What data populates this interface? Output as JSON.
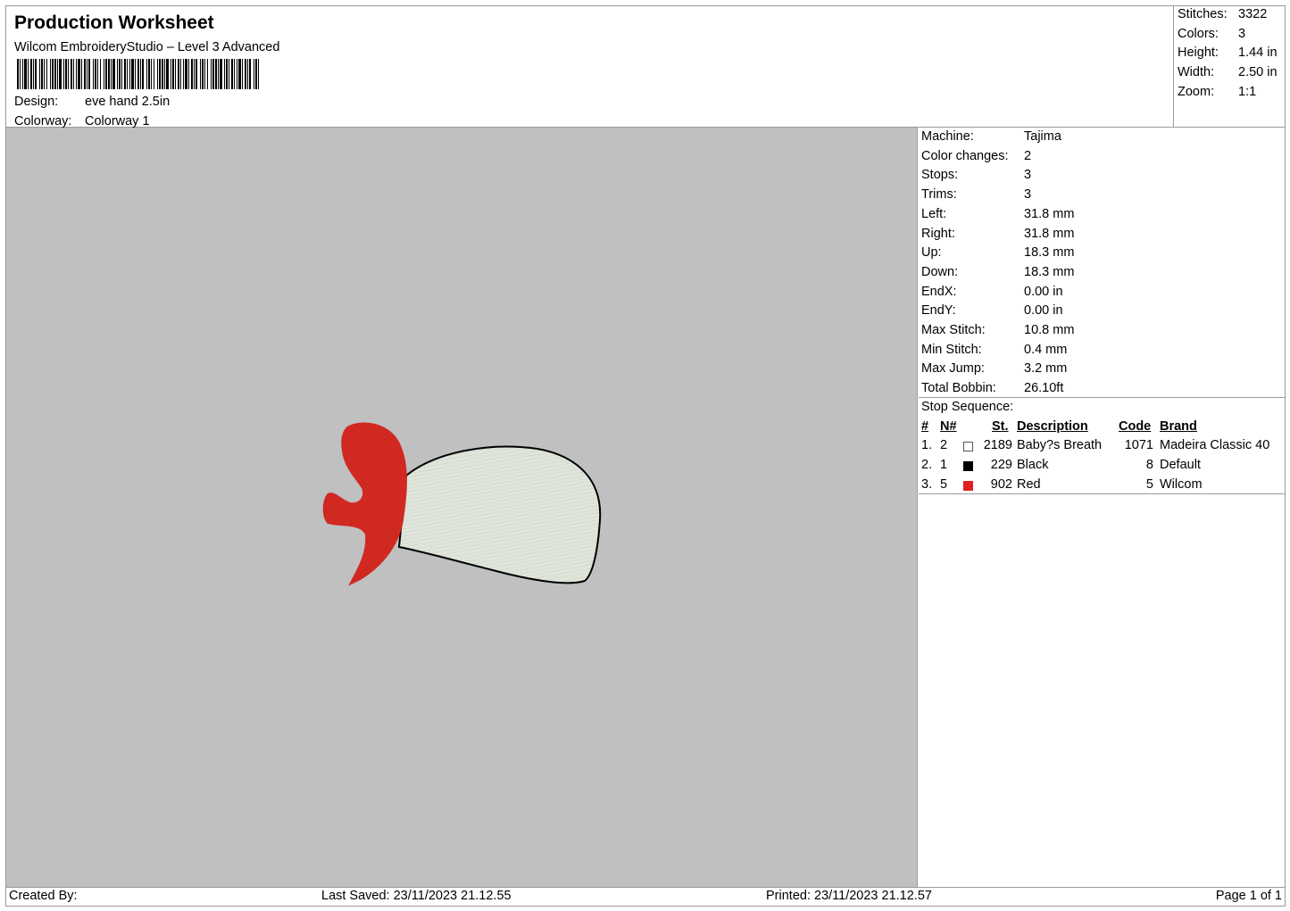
{
  "header": {
    "title": "Production Worksheet",
    "software": "Wilcom EmbroideryStudio – Level 3 Advanced",
    "design_label": "Design:",
    "design_value": "eve hand 2.5in",
    "colorway_label": "Colorway:",
    "colorway_value": "Colorway 1"
  },
  "summary": {
    "stitches_label": "Stitches:",
    "stitches": "3322",
    "colors_label": "Colors:",
    "colors": "3",
    "height_label": "Height:",
    "height": "1.44 in",
    "width_label": "Width:",
    "width": "2.50 in",
    "zoom_label": "Zoom:",
    "zoom": "1:1"
  },
  "machine_info": [
    {
      "label": "Machine:",
      "value": "Tajima"
    },
    {
      "label": "Color changes:",
      "value": "2"
    },
    {
      "label": "Stops:",
      "value": "3"
    },
    {
      "label": "Trims:",
      "value": "3"
    },
    {
      "label": "Left:",
      "value": "31.8 mm"
    },
    {
      "label": "Right:",
      "value": "31.8 mm"
    },
    {
      "label": "Up:",
      "value": "18.3 mm"
    },
    {
      "label": "Down:",
      "value": "18.3 mm"
    },
    {
      "label": "EndX:",
      "value": "0.00 in"
    },
    {
      "label": "EndY:",
      "value": "0.00 in"
    },
    {
      "label": "Max Stitch:",
      "value": "10.8 mm"
    },
    {
      "label": "Min Stitch:",
      "value": "0.4 mm"
    },
    {
      "label": "Max Jump:",
      "value": "3.2 mm"
    },
    {
      "label": "Total Bobbin:",
      "value": "26.10ft"
    }
  ],
  "stop_sequence": {
    "title": "Stop Sequence:",
    "headers": {
      "num": "#",
      "needle": "N#",
      "stitches": "St.",
      "description": "Description",
      "code": "Code",
      "brand": "Brand"
    },
    "rows": [
      {
        "num": "1.",
        "needle": "2",
        "color": "#ffffff",
        "stitches": "2189",
        "description": "Baby?s Breath",
        "code": "1071",
        "brand": "Madeira Classic 40"
      },
      {
        "num": "2.",
        "needle": "1",
        "color": "#000000",
        "stitches": "229",
        "description": "Black",
        "code": "8",
        "brand": "Default"
      },
      {
        "num": "3.",
        "needle": "5",
        "color": "#e02020",
        "stitches": "902",
        "description": "Red",
        "code": "5",
        "brand": "Wilcom"
      }
    ]
  },
  "footer": {
    "created_by": "Created By:",
    "last_saved": "Last Saved: 23/11/2023 21.12.55",
    "printed": "Printed: 23/11/2023 21.12.57",
    "page": "Page 1 of 1"
  },
  "design_colors": {
    "fill": "#dfe5da",
    "outline": "#000000",
    "accent": "#d42a22",
    "background": "#c0c0c0"
  }
}
